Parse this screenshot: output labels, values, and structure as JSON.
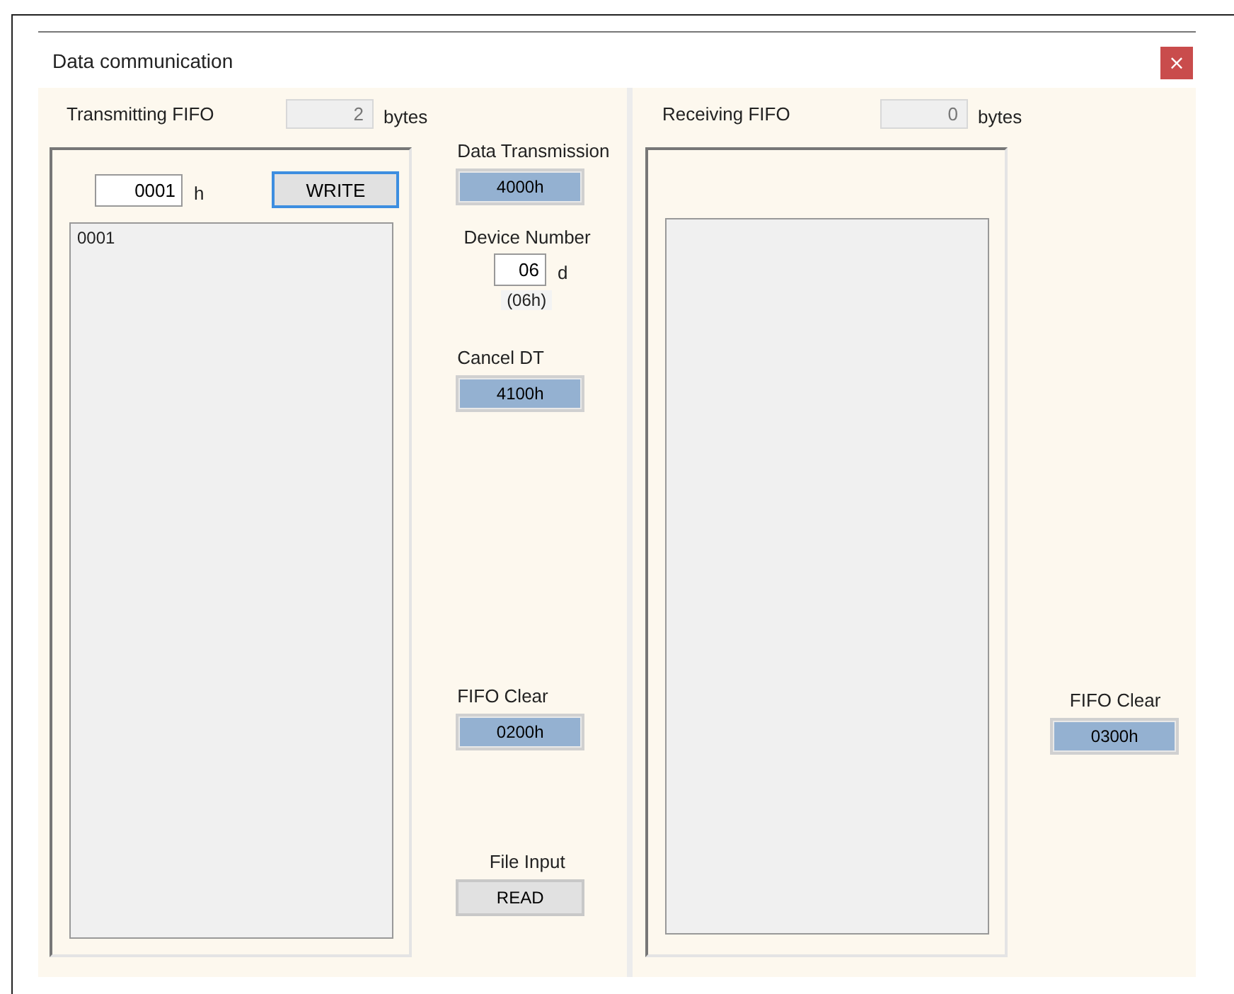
{
  "window": {
    "title": "Data communication",
    "close_icon": "×"
  },
  "transmitting": {
    "label": "Transmitting FIFO",
    "count": "2",
    "unit": "bytes",
    "entry": {
      "value": "0001",
      "suffix": "h"
    },
    "write_button": {
      "label": "WRITE",
      "focused": true
    },
    "items": [
      "0001"
    ]
  },
  "controls": [
    {
      "kind": "command",
      "label": "Data Transmission",
      "button": "4000h"
    },
    {
      "kind": "number",
      "label": "Device Number",
      "value": "06",
      "suffix": "d",
      "hex": "(06h)"
    },
    {
      "kind": "command",
      "label": "Cancel DT",
      "button": "4100h"
    },
    {
      "kind": "command",
      "label": "FIFO Clear",
      "button": "0200h"
    },
    {
      "kind": "file",
      "label": "File Input",
      "button": "READ"
    }
  ],
  "receiving": {
    "label": "Receiving FIFO",
    "count": "0",
    "unit": "bytes",
    "clear": {
      "kind": "command",
      "label": "FIFO Clear",
      "button": "0300h"
    }
  }
}
